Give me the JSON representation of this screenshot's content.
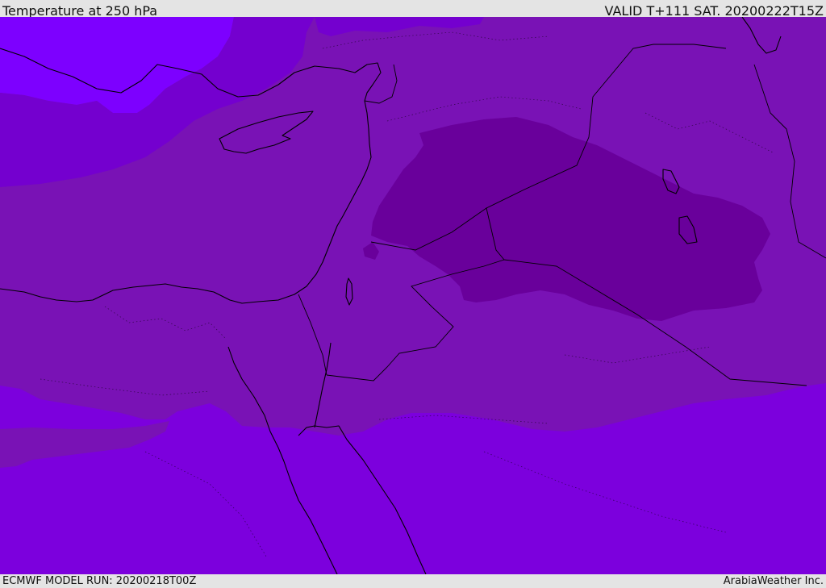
{
  "header": {
    "title": "Temperature at 250 hPa",
    "valid": "VALID T+111 SAT. 20200222T15Z"
  },
  "footer": {
    "model_run": "ECMWF MODEL RUN: 20200218T00Z",
    "credit": "ArabiaWeather Inc."
  },
  "map": {
    "colors": {
      "cold_band": "#7d00ff",
      "mid_band": "#7400cf",
      "base_band": "#7912b5",
      "core_band": "#69009b",
      "lower_band": "#7c00dd",
      "coastline": "#000000"
    }
  }
}
